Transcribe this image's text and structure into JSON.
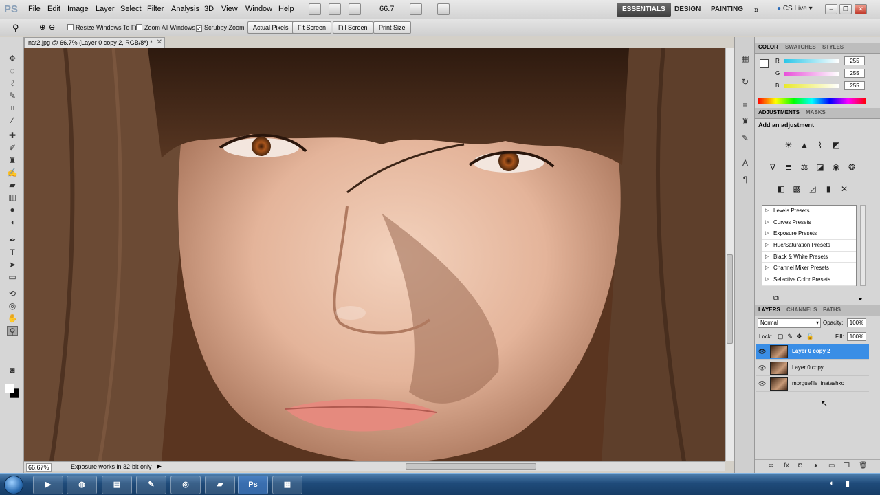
{
  "app": {
    "logo": "PS"
  },
  "menu": [
    "File",
    "Edit",
    "Image",
    "Layer",
    "Select",
    "Filter",
    "Analysis",
    "3D",
    "View",
    "Window",
    "Help"
  ],
  "menubar": {
    "zoom": "66.7",
    "workspaces": [
      "ESSENTIALS",
      "DESIGN",
      "PAINTING"
    ],
    "cs_live": "CS Live"
  },
  "options": {
    "resize_windows": "Resize Windows To Fit",
    "zoom_all_windows": "Zoom All Windows",
    "scrubby_zoom": "Scrubby Zoom",
    "buttons": [
      "Actual Pixels",
      "Fit Screen",
      "Fill Screen",
      "Print Size"
    ]
  },
  "document": {
    "tab": "nat2.jpg @ 66.7% (Layer 0 copy 2, RGB/8*) *",
    "zoom": "66.67%",
    "status": "Exposure works in 32-bit only"
  },
  "color_panel": {
    "tabs": [
      "COLOR",
      "SWATCHES",
      "STYLES"
    ],
    "channels": [
      {
        "label": "R",
        "value": "255",
        "color": "#29c6e8"
      },
      {
        "label": "G",
        "value": "255",
        "color": "#e84fd9"
      },
      {
        "label": "B",
        "value": "255",
        "color": "#e8e82a"
      }
    ]
  },
  "adjustments": {
    "tabs": [
      "ADJUSTMENTS",
      "MASKS"
    ],
    "title": "Add an adjustment",
    "presets": [
      "Levels Presets",
      "Curves Presets",
      "Exposure Presets",
      "Hue/Saturation Presets",
      "Black & White Presets",
      "Channel Mixer Presets",
      "Selective Color Presets"
    ]
  },
  "layers_panel": {
    "tabs": [
      "LAYERS",
      "CHANNELS",
      "PATHS"
    ],
    "blend_mode": "Normal",
    "opacity_label": "Opacity:",
    "opacity": "100%",
    "lock_label": "Lock:",
    "fill_label": "Fill:",
    "fill": "100%",
    "layers": [
      "Layer 0 copy 2",
      "Layer 0 copy",
      "morguefile_inatashko"
    ]
  },
  "taskbar": {
    "ps_label": "Ps"
  }
}
